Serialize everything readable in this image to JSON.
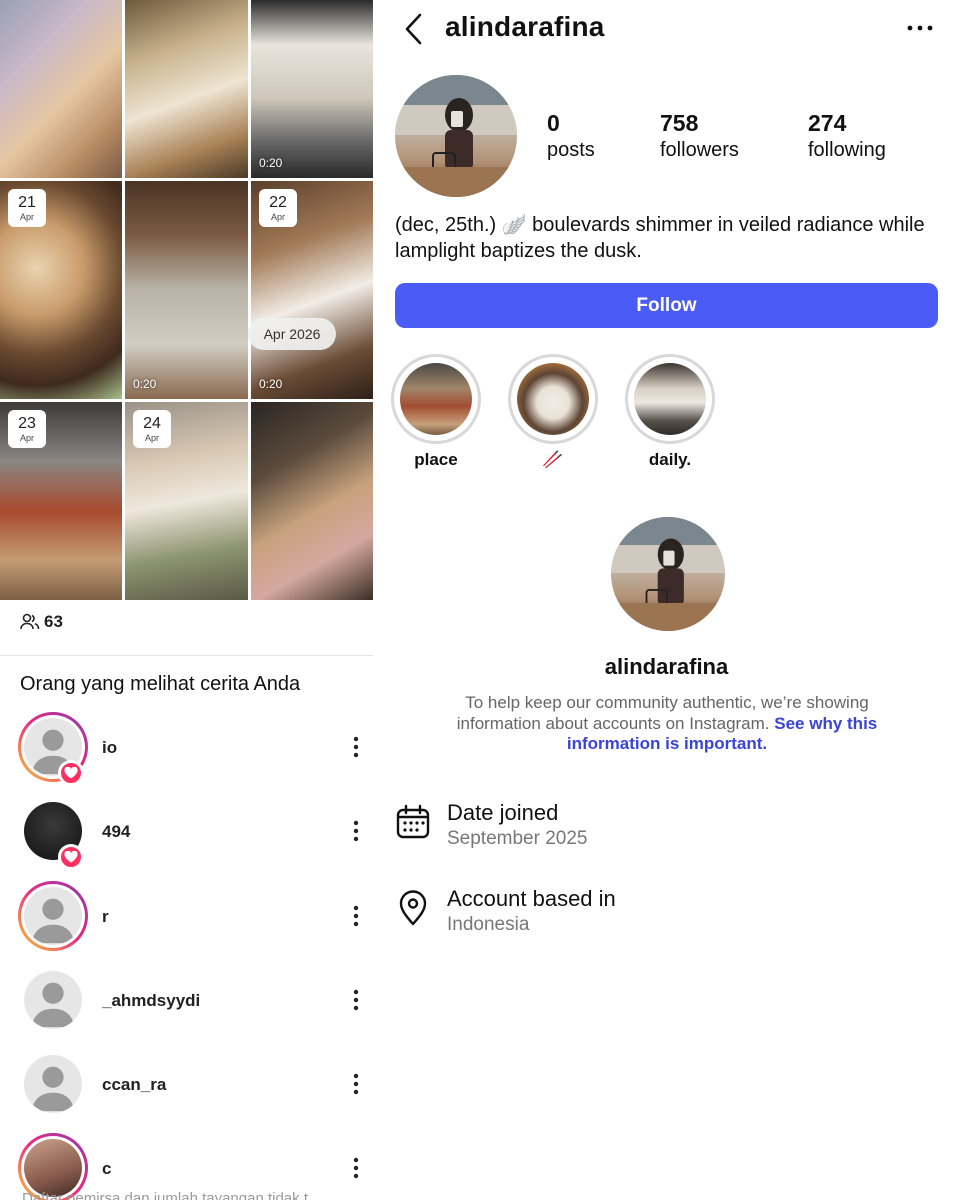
{
  "story_archive": {
    "tiles": [
      {
        "day": "",
        "month": "",
        "duration": ""
      },
      {
        "day": "",
        "month": "",
        "duration": ""
      },
      {
        "day": "",
        "month": "",
        "duration": "0:20"
      },
      {
        "day": "21",
        "month": "Apr",
        "duration": ""
      },
      {
        "day": "",
        "month": "",
        "duration": "0:20"
      },
      {
        "day": "22",
        "month": "Apr",
        "duration": "0:20"
      },
      {
        "day": "23",
        "month": "Apr",
        "duration": ""
      },
      {
        "day": "24",
        "month": "Apr",
        "duration": ""
      },
      {
        "day": "",
        "month": "",
        "duration": ""
      }
    ],
    "month_pill": "Apr 2026"
  },
  "viewers": {
    "count": "63",
    "section_title": "Orang yang melihat cerita Anda",
    "list": [
      {
        "username": "io",
        "ring": true,
        "liked": true,
        "avatar": "default"
      },
      {
        "username": "494",
        "ring": false,
        "liked": true,
        "avatar": "dark"
      },
      {
        "username": "r",
        "ring": true,
        "liked": false,
        "avatar": "default"
      },
      {
        "username": "_ahmdsyydi",
        "ring": false,
        "liked": false,
        "avatar": "default"
      },
      {
        "username": "ccan_ra",
        "ring": false,
        "liked": false,
        "avatar": "default"
      },
      {
        "username": "c",
        "ring": true,
        "liked": false,
        "avatar": "photo"
      }
    ],
    "footer_note": "Daftar pemirsa dan jumlah tayangan tidak t"
  },
  "profile": {
    "username": "alindarafina",
    "stats": [
      {
        "value": "0",
        "label": "posts"
      },
      {
        "value": "758",
        "label": "followers"
      },
      {
        "value": "274",
        "label": "following"
      }
    ],
    "bio": "(dec, 25th.) 🪽 boulevards shimmer in veiled radiance while lamplight baptizes the dusk.",
    "follow_label": "Follow",
    "highlights": [
      {
        "label": "place"
      },
      {
        "label": "🥢"
      },
      {
        "label": "daily."
      }
    ]
  },
  "about": {
    "username": "alindarafina",
    "description": "To help keep our community authentic, we’re showing information about accounts on Instagram.",
    "link_text": "See why this information is important.",
    "date_joined_label": "Date joined",
    "date_joined_value": "September 2025",
    "based_in_label": "Account based in",
    "based_in_value": "Indonesia"
  },
  "colors": {
    "follow_button": "#4a5cf5",
    "link": "#3a44d8",
    "heart": "#ff3060",
    "story_ring": [
      "#f9ce34",
      "#ee2a7b",
      "#8a3ab9"
    ]
  },
  "icons": [
    "back-arrow-icon",
    "more-horizontal-icon",
    "calendar-icon",
    "location-pin-icon",
    "people-icon",
    "more-vertical-icon",
    "heart-icon",
    "person-placeholder-icon"
  ]
}
